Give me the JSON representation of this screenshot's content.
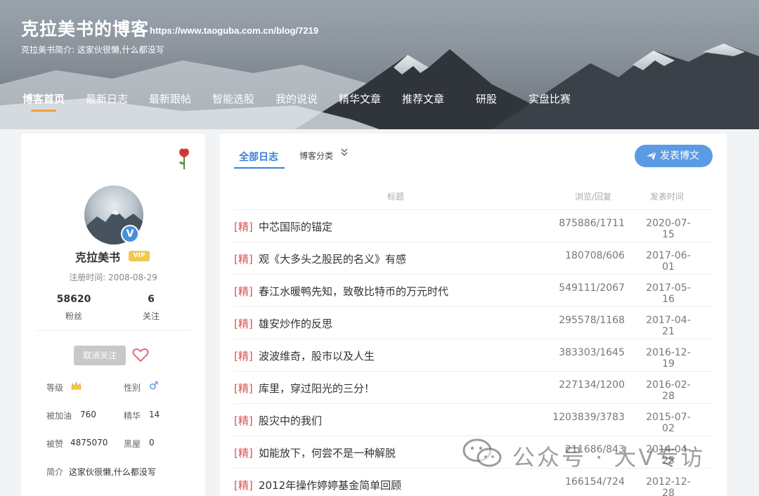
{
  "header": {
    "title": "克拉美书的博客",
    "url": "https://www.taoguba.com.cn/blog/7219",
    "intro": "克拉美书简介: 这家伙很懒,什么都没写"
  },
  "nav": {
    "items": [
      "博客首页",
      "最新日志",
      "最新跟帖",
      "智能选股",
      "我的说说",
      "精华文章",
      "推荐文章",
      "研股",
      "实盘比赛"
    ],
    "active_index": 0
  },
  "profile": {
    "rose_icon": "rose-icon",
    "name": "克拉美书",
    "vip": "VIP",
    "verified_icon": "verified-v-icon",
    "verified_mark": "V",
    "reg_time": "注册时间: 2008-08-29",
    "followers": {
      "value": "58620",
      "label": "粉丝"
    },
    "following": {
      "value": "6",
      "label": "关注"
    },
    "unfollow_label": "取消关注",
    "heart_icon": "heart-icon",
    "level_label": "等级",
    "level_icon": "crown-icon",
    "gender_label": "性别",
    "gender_icon": "male-icon",
    "gender_glyph": "♂",
    "boost_label": "被加油",
    "boost_value": "760",
    "essence_label": "精华",
    "essence_value": "14",
    "likes_label": "被赞",
    "likes_value": "4875070",
    "blackroom_label": "黑屋",
    "blackroom_value": "0",
    "bio_label": "简介",
    "bio_value": "这家伙很懒,什么都没写"
  },
  "main": {
    "tab_all": "全部日志",
    "tab_category": "博客分类",
    "post_button": "发表博文",
    "columns": {
      "title": "标题",
      "views": "浏览/回复",
      "date": "发表时间"
    },
    "rows": [
      {
        "tag": "[精]",
        "title": "中芯国际的锚定",
        "views": "875886/1711",
        "date": "2020-07-15"
      },
      {
        "tag": "[精]",
        "title": "观《大多头之股民的名义》有感",
        "views": "180708/606",
        "date": "2017-06-01"
      },
      {
        "tag": "[精]",
        "title": "春江水暖鸭先知，致敬比特币的万元时代",
        "views": "549111/2067",
        "date": "2017-05-16"
      },
      {
        "tag": "[精]",
        "title": "雄安炒作的反思",
        "views": "295578/1168",
        "date": "2017-04-21"
      },
      {
        "tag": "[精]",
        "title": "波波维奇，股市以及人生",
        "views": "383303/1645",
        "date": "2016-12-19"
      },
      {
        "tag": "[精]",
        "title": "库里，穿过阳光的三分！",
        "views": "227134/1200",
        "date": "2016-02-28"
      },
      {
        "tag": "[精]",
        "title": "股灾中的我们",
        "views": "1203839/3783",
        "date": "2015-07-02"
      },
      {
        "tag": "[精]",
        "title": "如能放下，何尝不是一种解脱",
        "views": "211686/843",
        "date": "2014-04-25"
      },
      {
        "tag": "[精]",
        "title": "2012年操作婷婷基金简单回顾",
        "views": "166154/724",
        "date": "2012-12-28"
      }
    ]
  },
  "watermark": {
    "text": "公众号 · 大V专访",
    "icon": "wechat-icon"
  },
  "colors": {
    "accent": "#3a80d6",
    "tag": "#d9534f",
    "nav_active": "#f0a040"
  }
}
